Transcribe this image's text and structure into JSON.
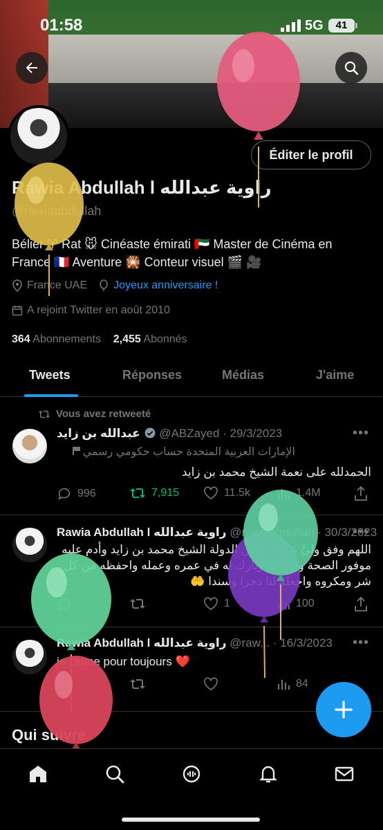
{
  "status_bar": {
    "time": "01:58",
    "network": "5G",
    "battery": "41"
  },
  "profile": {
    "edit_label": "Éditer le profil",
    "name": "Rawia Abdullah l راوية عبدالله",
    "handle": "@rawiaabdullah",
    "bio_line1": "Bélier ♈ Rat 🐭 Cinéaste émirati 🇦🇪 Master de Cinéma en",
    "bio_line2": "France 🇫🇷 Aventure 🎇 Conteur visuel 🎬 🎥",
    "location": "France UAE",
    "birthday_link": "Joyeux anniversaire !",
    "joined": "A rejoint Twitter en août 2010",
    "following_count": "364",
    "following_label": "Abonnements",
    "followers_count": "2,455",
    "followers_label": "Abonnés"
  },
  "tabs": [
    "Tweets",
    "Réponses",
    "Médias",
    "J'aime"
  ],
  "retweet_label": "Vous avez retweeté",
  "tweets": [
    {
      "author": "عبدالله بن زايد",
      "handle": "@ABZayed",
      "date": "· 29/3/2023",
      "label": "الإمارات العربية المتحدة حساب حكومي رسمي",
      "text": "الحمدلله على نعمة الشيخ محمد بن زايد",
      "replies": "996",
      "retweets": "7,915",
      "likes": "11.5k",
      "views": "1.4M"
    },
    {
      "author": "Rawia Abdullah l راوية عبدالله",
      "handle": "@rawiaabdullah",
      "date": "· 30/3/2023",
      "text": "اللهم وفق وليَّ عهدنا رئيس الدولة الشيخ محمد بن زايد وأدم عليه موفور الصحة والعافية وبارك له في عمره وعمله واحفظه من كل شر ومكروه واجعله لنا ذخرا وسندا 🤲",
      "likes": "1",
      "views": "100"
    },
    {
      "author": "Rawia Abdullah l راوية عبدالله",
      "handle": "@raw...",
      "date": "· 16/3/2023",
      "text": "je t'aime pour toujours ❤️",
      "views": "84"
    }
  ],
  "who_to_follow": "Qui suivre",
  "icons": [
    "back-arrow-icon",
    "search-icon",
    "location-icon",
    "balloon-icon",
    "calendar-icon",
    "retweet-icon",
    "reply-icon",
    "like-icon",
    "views-icon",
    "share-icon",
    "compose-plus-icon",
    "home-icon",
    "explore-icon",
    "spaces-icon",
    "bell-icon",
    "mail-icon"
  ],
  "colors": {
    "accent": "#1d9bf0",
    "retweet_green": "#00ba7c",
    "muted": "#71767b"
  }
}
